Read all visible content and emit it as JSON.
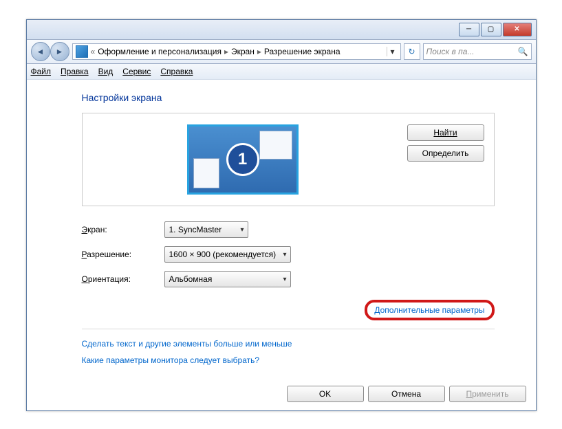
{
  "breadcrumb": {
    "seg1": "Оформление и персонализация",
    "seg2": "Экран",
    "seg3": "Разрешение экрана"
  },
  "search": {
    "placeholder": "Поиск в па..."
  },
  "menu": {
    "file": "Файл",
    "edit": "Правка",
    "view": "Вид",
    "tools": "Сервис",
    "help": "Справка"
  },
  "heading": "Настройки экрана",
  "monitor_number": "1",
  "buttons": {
    "find": "Найти",
    "detect": "Определить",
    "ok": "OK",
    "cancel": "Отмена",
    "apply": "Применить"
  },
  "labels": {
    "display": "Экран:",
    "resolution": "Разрешение:",
    "orientation": "Ориентация:"
  },
  "values": {
    "display": "1. SyncMaster",
    "resolution": "1600 × 900 (рекомендуется)",
    "orientation": "Альбомная"
  },
  "links": {
    "advanced": "Дополнительные параметры",
    "text_size": "Сделать текст и другие элементы больше или меньше",
    "which_settings": "Какие параметры монитора следует выбрать?"
  }
}
